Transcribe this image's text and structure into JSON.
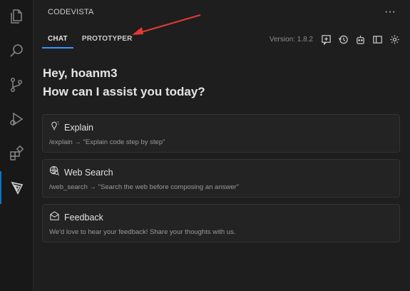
{
  "panel": {
    "title": "CODEVISTA"
  },
  "tabs": [
    {
      "label": "CHAT"
    },
    {
      "label": "PROTOTYPER"
    }
  ],
  "toolbar": {
    "version": "Version: 1.8.2"
  },
  "greeting": {
    "line1": "Hey, hoanm3",
    "line2": "How can I assist you today?"
  },
  "cards": [
    {
      "title": "Explain",
      "desc": "/explain → \"Explain code step by step\""
    },
    {
      "title": "Web Search",
      "desc": "/web_search → \"Search the web before composing an answer\""
    },
    {
      "title": "Feedback",
      "desc": "We'd love to hear your feedback! Share your thoughts with us."
    }
  ],
  "colors": {
    "accent": "#3794ff",
    "annotation_arrow": "#e53935"
  },
  "icons": [
    "explorer-icon",
    "search-icon",
    "source-control-icon",
    "run-debug-icon",
    "extensions-icon",
    "codevista-icon",
    "more-actions-icon",
    "new-chat-icon",
    "history-icon",
    "bot-icon",
    "layout-icon",
    "settings-icon",
    "lightbulb-icon",
    "web-search-icon",
    "mail-icon"
  ]
}
